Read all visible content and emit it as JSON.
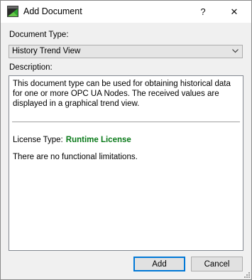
{
  "window": {
    "title": "Add Document",
    "help_glyph": "?",
    "close_glyph": "✕",
    "icon": "app-icon"
  },
  "form": {
    "document_type_label": "Document Type:",
    "document_type_value": "History Trend View",
    "description_label": "Description:",
    "description_text": "This document type can be used for obtaining historical data for one or more OPC UA Nodes. The received values are displayed in a graphical trend view.",
    "license_label": "License Type:",
    "license_value": "Runtime License",
    "limitations_text": "There are no functional limitations."
  },
  "buttons": {
    "add": "Add",
    "cancel": "Cancel"
  },
  "colors": {
    "license_value": "#0a7a1a",
    "default_button_border": "#0078d7"
  }
}
